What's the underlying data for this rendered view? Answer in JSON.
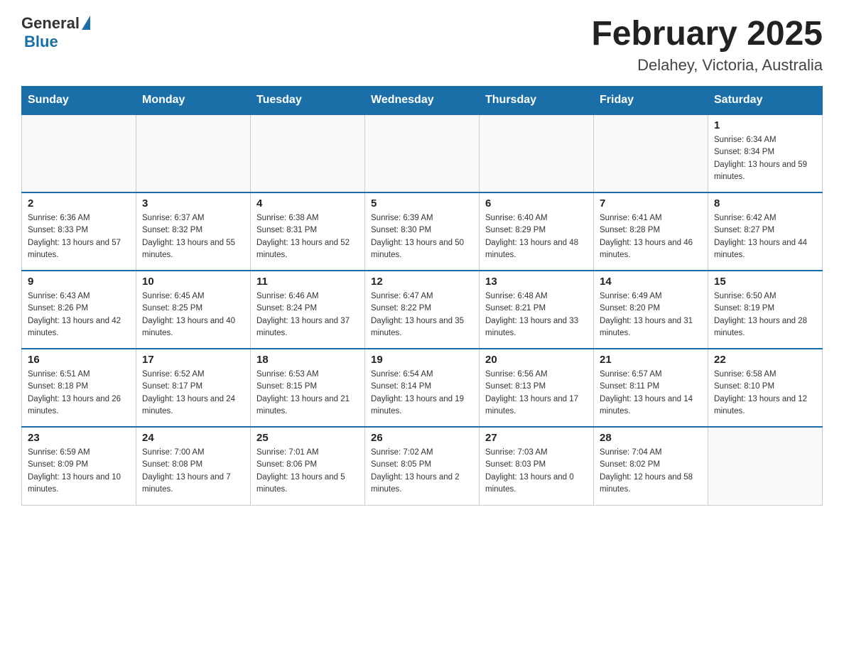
{
  "header": {
    "logo_general": "General",
    "logo_blue": "Blue",
    "title": "February 2025",
    "subtitle": "Delahey, Victoria, Australia"
  },
  "days_of_week": [
    "Sunday",
    "Monday",
    "Tuesday",
    "Wednesday",
    "Thursday",
    "Friday",
    "Saturday"
  ],
  "weeks": [
    [
      {
        "day": "",
        "info": ""
      },
      {
        "day": "",
        "info": ""
      },
      {
        "day": "",
        "info": ""
      },
      {
        "day": "",
        "info": ""
      },
      {
        "day": "",
        "info": ""
      },
      {
        "day": "",
        "info": ""
      },
      {
        "day": "1",
        "info": "Sunrise: 6:34 AM\nSunset: 8:34 PM\nDaylight: 13 hours and 59 minutes."
      }
    ],
    [
      {
        "day": "2",
        "info": "Sunrise: 6:36 AM\nSunset: 8:33 PM\nDaylight: 13 hours and 57 minutes."
      },
      {
        "day": "3",
        "info": "Sunrise: 6:37 AM\nSunset: 8:32 PM\nDaylight: 13 hours and 55 minutes."
      },
      {
        "day": "4",
        "info": "Sunrise: 6:38 AM\nSunset: 8:31 PM\nDaylight: 13 hours and 52 minutes."
      },
      {
        "day": "5",
        "info": "Sunrise: 6:39 AM\nSunset: 8:30 PM\nDaylight: 13 hours and 50 minutes."
      },
      {
        "day": "6",
        "info": "Sunrise: 6:40 AM\nSunset: 8:29 PM\nDaylight: 13 hours and 48 minutes."
      },
      {
        "day": "7",
        "info": "Sunrise: 6:41 AM\nSunset: 8:28 PM\nDaylight: 13 hours and 46 minutes."
      },
      {
        "day": "8",
        "info": "Sunrise: 6:42 AM\nSunset: 8:27 PM\nDaylight: 13 hours and 44 minutes."
      }
    ],
    [
      {
        "day": "9",
        "info": "Sunrise: 6:43 AM\nSunset: 8:26 PM\nDaylight: 13 hours and 42 minutes."
      },
      {
        "day": "10",
        "info": "Sunrise: 6:45 AM\nSunset: 8:25 PM\nDaylight: 13 hours and 40 minutes."
      },
      {
        "day": "11",
        "info": "Sunrise: 6:46 AM\nSunset: 8:24 PM\nDaylight: 13 hours and 37 minutes."
      },
      {
        "day": "12",
        "info": "Sunrise: 6:47 AM\nSunset: 8:22 PM\nDaylight: 13 hours and 35 minutes."
      },
      {
        "day": "13",
        "info": "Sunrise: 6:48 AM\nSunset: 8:21 PM\nDaylight: 13 hours and 33 minutes."
      },
      {
        "day": "14",
        "info": "Sunrise: 6:49 AM\nSunset: 8:20 PM\nDaylight: 13 hours and 31 minutes."
      },
      {
        "day": "15",
        "info": "Sunrise: 6:50 AM\nSunset: 8:19 PM\nDaylight: 13 hours and 28 minutes."
      }
    ],
    [
      {
        "day": "16",
        "info": "Sunrise: 6:51 AM\nSunset: 8:18 PM\nDaylight: 13 hours and 26 minutes."
      },
      {
        "day": "17",
        "info": "Sunrise: 6:52 AM\nSunset: 8:17 PM\nDaylight: 13 hours and 24 minutes."
      },
      {
        "day": "18",
        "info": "Sunrise: 6:53 AM\nSunset: 8:15 PM\nDaylight: 13 hours and 21 minutes."
      },
      {
        "day": "19",
        "info": "Sunrise: 6:54 AM\nSunset: 8:14 PM\nDaylight: 13 hours and 19 minutes."
      },
      {
        "day": "20",
        "info": "Sunrise: 6:56 AM\nSunset: 8:13 PM\nDaylight: 13 hours and 17 minutes."
      },
      {
        "day": "21",
        "info": "Sunrise: 6:57 AM\nSunset: 8:11 PM\nDaylight: 13 hours and 14 minutes."
      },
      {
        "day": "22",
        "info": "Sunrise: 6:58 AM\nSunset: 8:10 PM\nDaylight: 13 hours and 12 minutes."
      }
    ],
    [
      {
        "day": "23",
        "info": "Sunrise: 6:59 AM\nSunset: 8:09 PM\nDaylight: 13 hours and 10 minutes."
      },
      {
        "day": "24",
        "info": "Sunrise: 7:00 AM\nSunset: 8:08 PM\nDaylight: 13 hours and 7 minutes."
      },
      {
        "day": "25",
        "info": "Sunrise: 7:01 AM\nSunset: 8:06 PM\nDaylight: 13 hours and 5 minutes."
      },
      {
        "day": "26",
        "info": "Sunrise: 7:02 AM\nSunset: 8:05 PM\nDaylight: 13 hours and 2 minutes."
      },
      {
        "day": "27",
        "info": "Sunrise: 7:03 AM\nSunset: 8:03 PM\nDaylight: 13 hours and 0 minutes."
      },
      {
        "day": "28",
        "info": "Sunrise: 7:04 AM\nSunset: 8:02 PM\nDaylight: 12 hours and 58 minutes."
      },
      {
        "day": "",
        "info": ""
      }
    ]
  ]
}
